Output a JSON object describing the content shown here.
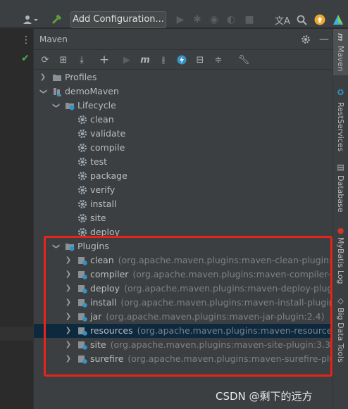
{
  "topbar": {
    "run_config_label": "Add Configuration...",
    "colors": {
      "build_icon": "#5f9e3f",
      "update_icon": "#f0a732"
    }
  },
  "panel": {
    "title": "Maven"
  },
  "tree": {
    "profiles": "Profiles",
    "project": "demoMaven",
    "lifecycle": "Lifecycle",
    "lifecycle_items": [
      "clean",
      "validate",
      "compile",
      "test",
      "package",
      "verify",
      "install",
      "site",
      "deploy"
    ],
    "plugins": "Plugins",
    "plugin_items": [
      {
        "name": "clean",
        "desc": "(org.apache.maven.plugins:maven-clean-plugin:2.5)"
      },
      {
        "name": "compiler",
        "desc": "(org.apache.maven.plugins:maven-compiler-plugin"
      },
      {
        "name": "deploy",
        "desc": "(org.apache.maven.plugins:maven-deploy-plugin:2.7"
      },
      {
        "name": "install",
        "desc": "(org.apache.maven.plugins:maven-install-plugin:2.4)"
      },
      {
        "name": "jar",
        "desc": "(org.apache.maven.plugins:maven-jar-plugin:2.4)"
      },
      {
        "name": "resources",
        "desc": "(org.apache.maven.plugins:maven-resources-plug"
      },
      {
        "name": "site",
        "desc": "(org.apache.maven.plugins:maven-site-plugin:3.3)"
      },
      {
        "name": "surefire",
        "desc": "(org.apache.maven.plugins:maven-surefire-plugin:2"
      }
    ],
    "selected_plugin": "resources"
  },
  "rightbar": {
    "tabs": [
      "Maven",
      "RestServices",
      "Database",
      "MyBatis Log",
      "Big Data Tools"
    ]
  },
  "watermark": "CSDN @剩下的远方"
}
